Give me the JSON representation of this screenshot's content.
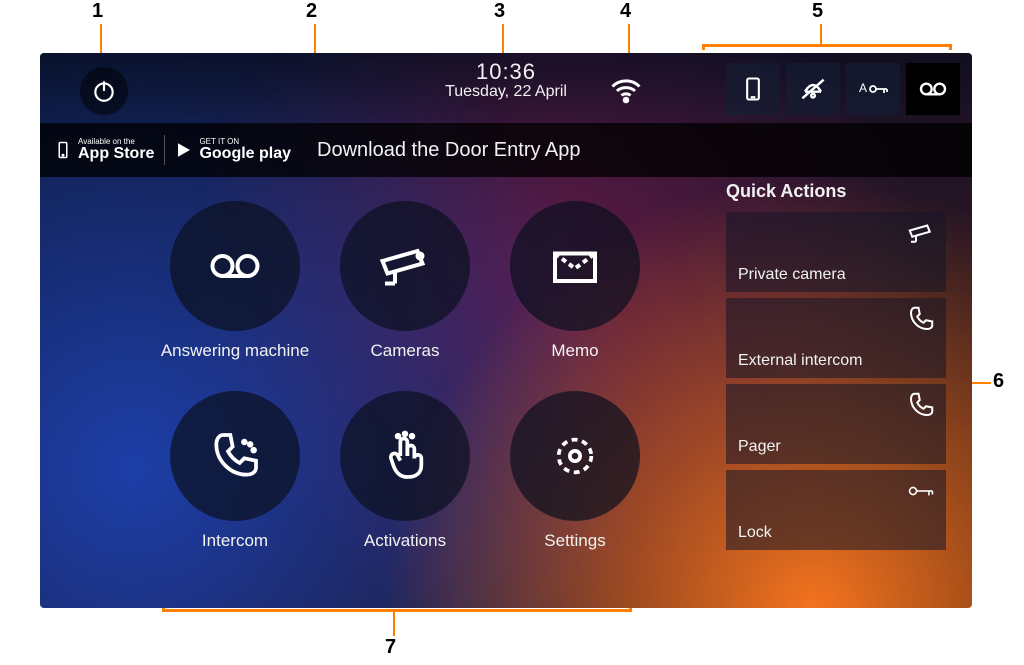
{
  "callouts": [
    "1",
    "2",
    "3",
    "4",
    "5",
    "6",
    "7"
  ],
  "clock": {
    "time": "10:36",
    "date": "Tuesday, 22 April"
  },
  "banner": {
    "appstore_top": "Available on the",
    "appstore_bottom": "App Store",
    "google_top": "GET IT ON",
    "google_bottom": "Google play",
    "text": "Download the Door Entry App"
  },
  "tiles": {
    "answering": "Answering machine",
    "cameras": "Cameras",
    "memo": "Memo",
    "intercom": "Intercom",
    "activations": "Activations",
    "settings": "Settings"
  },
  "quick_actions": {
    "title": "Quick Actions",
    "items": [
      {
        "label": "Private camera",
        "icon": "camera"
      },
      {
        "label": "External intercom",
        "icon": "phone"
      },
      {
        "label": "Pager",
        "icon": "phone"
      },
      {
        "label": "Lock",
        "icon": "key"
      }
    ]
  }
}
